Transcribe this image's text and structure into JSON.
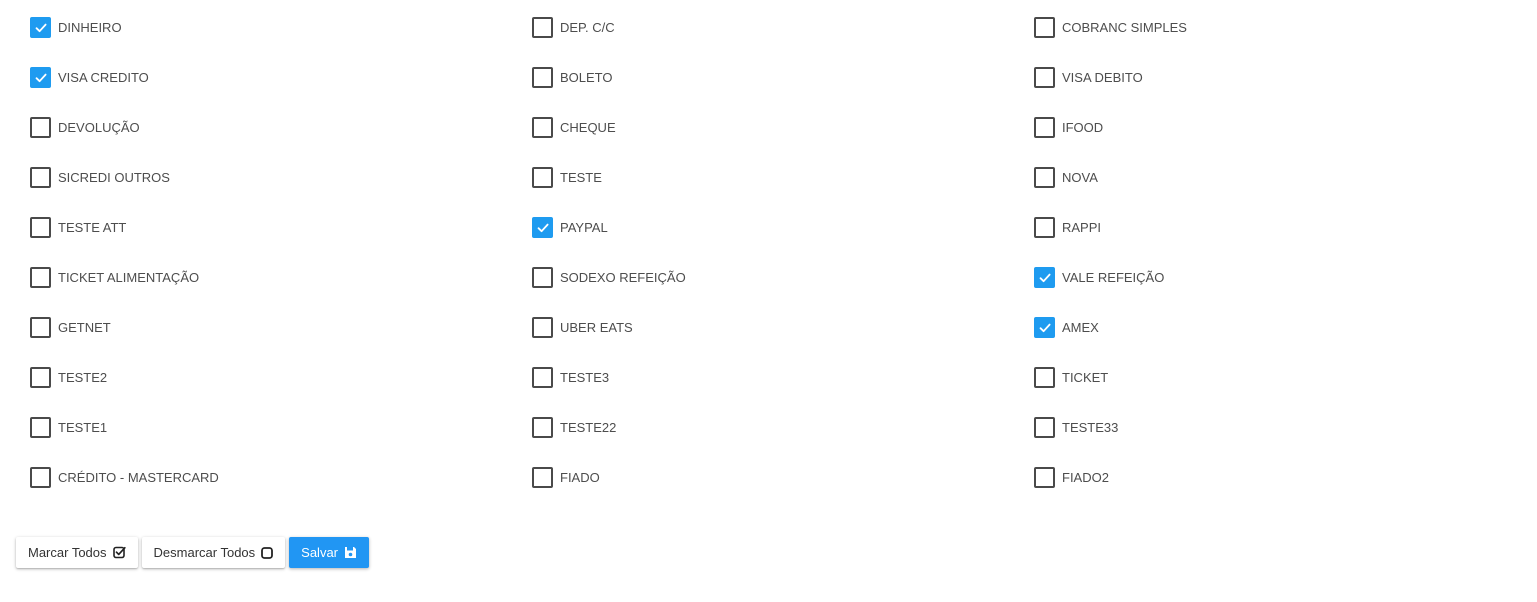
{
  "payment_methods": [
    {
      "label": "DINHEIRO",
      "checked": true
    },
    {
      "label": "DEP. C/C",
      "checked": false
    },
    {
      "label": "COBRANC SIMPLES",
      "checked": false
    },
    {
      "label": "VISA CREDITO",
      "checked": true
    },
    {
      "label": "BOLETO",
      "checked": false
    },
    {
      "label": "VISA DEBITO",
      "checked": false
    },
    {
      "label": "DEVOLUÇÃO",
      "checked": false
    },
    {
      "label": "CHEQUE",
      "checked": false
    },
    {
      "label": "IFOOD",
      "checked": false
    },
    {
      "label": "SICREDI OUTROS",
      "checked": false
    },
    {
      "label": "TESTE",
      "checked": false
    },
    {
      "label": "NOVA",
      "checked": false
    },
    {
      "label": "TESTE ATT",
      "checked": false
    },
    {
      "label": "PAYPAL",
      "checked": true
    },
    {
      "label": "RAPPI",
      "checked": false
    },
    {
      "label": "TICKET ALIMENTAÇÃO",
      "checked": false
    },
    {
      "label": "SODEXO REFEIÇÃO",
      "checked": false
    },
    {
      "label": "VALE REFEIÇÃO",
      "checked": true
    },
    {
      "label": "GETNET",
      "checked": false
    },
    {
      "label": "UBER EATS",
      "checked": false
    },
    {
      "label": "AMEX",
      "checked": true
    },
    {
      "label": "TESTE2",
      "checked": false
    },
    {
      "label": "TESTE3",
      "checked": false
    },
    {
      "label": "TICKET",
      "checked": false
    },
    {
      "label": "TESTE1",
      "checked": false
    },
    {
      "label": "TESTE22",
      "checked": false
    },
    {
      "label": "TESTE33",
      "checked": false
    },
    {
      "label": "CRÉDITO - MASTERCARD",
      "checked": false
    },
    {
      "label": "FIADO",
      "checked": false
    },
    {
      "label": "FIADO2",
      "checked": false
    }
  ],
  "toolbar": {
    "select_all_label": "Marcar Todos",
    "select_all_icon": "check-square-icon",
    "deselect_all_label": "Desmarcar Todos",
    "deselect_all_icon": "square-icon",
    "save_label": "Salvar",
    "save_icon": "floppy-disk-icon"
  },
  "colors": {
    "checkbox_checked": "#1e9bf0",
    "save_button": "#2196f3"
  }
}
